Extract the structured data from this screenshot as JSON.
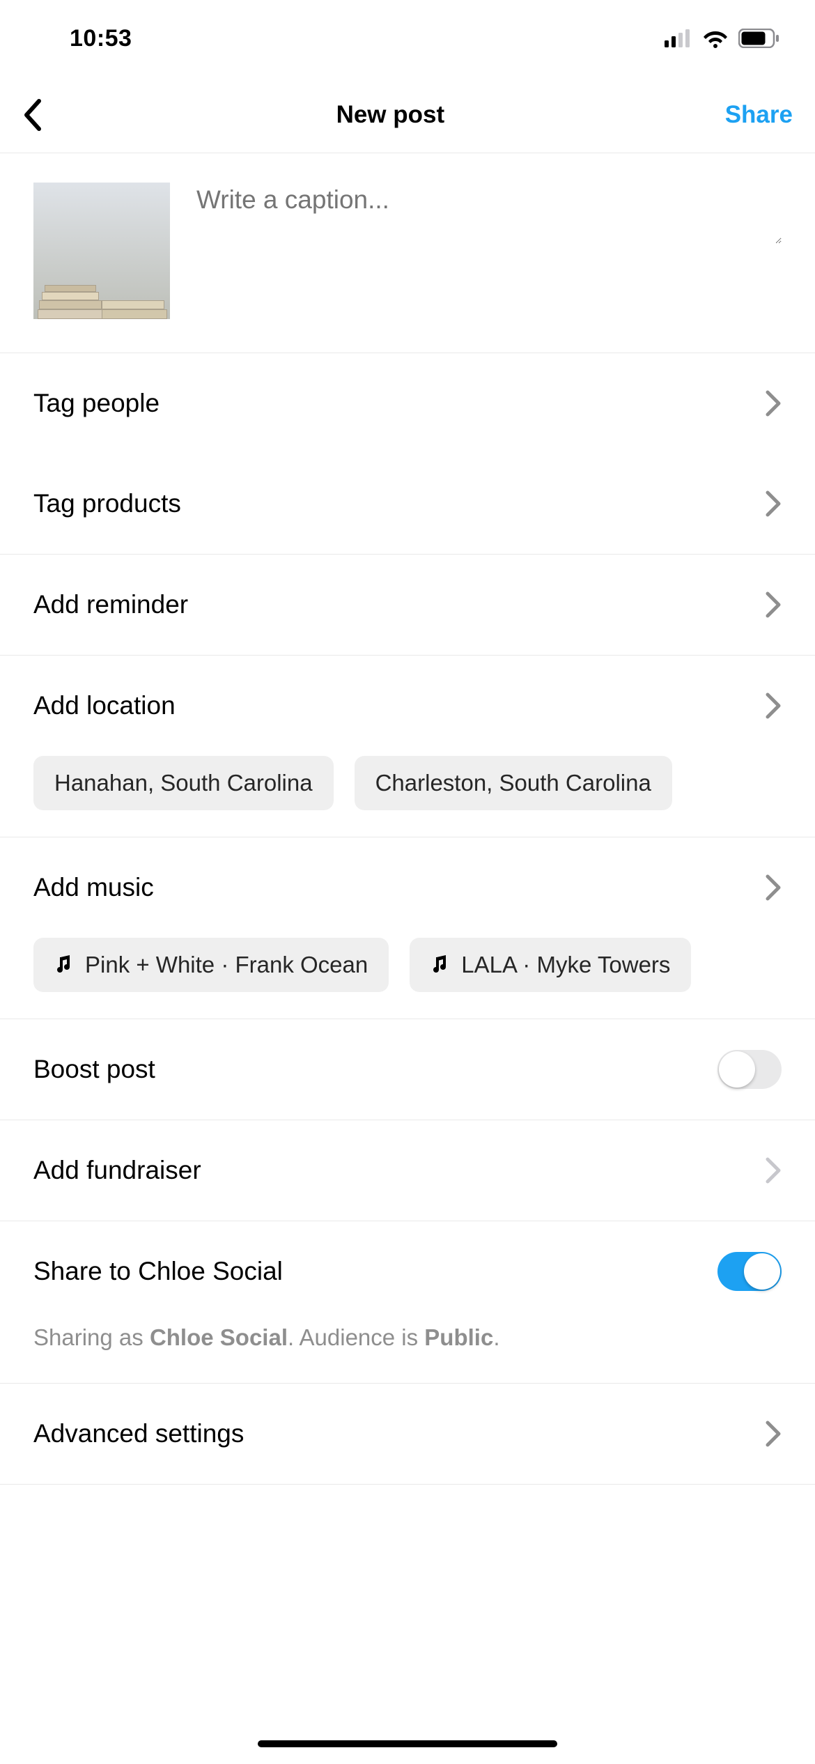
{
  "statusbar": {
    "time": "10:53"
  },
  "navbar": {
    "title": "New post",
    "share_label": "Share"
  },
  "caption": {
    "placeholder": "Write a caption..."
  },
  "rows": {
    "tag_people": "Tag people",
    "tag_products": "Tag products",
    "add_reminder": "Add reminder",
    "add_location": "Add location",
    "add_music": "Add music",
    "boost_post": "Boost post",
    "add_fundraiser": "Add fundraiser",
    "share_to": "Share to Chloe Social",
    "advanced": "Advanced settings"
  },
  "location_suggestions": [
    "Hanahan, South Carolina",
    "Charleston, South Carolina"
  ],
  "music_suggestions": [
    "Pink + White · Frank Ocean",
    "LALA · Myke Towers"
  ],
  "share_info": {
    "prefix": "Sharing as ",
    "page_name": "Chloe Social",
    "mid": ". Audience is ",
    "audience": "Public",
    "suffix": "."
  },
  "toggles": {
    "boost_post": false,
    "share_to": true
  }
}
